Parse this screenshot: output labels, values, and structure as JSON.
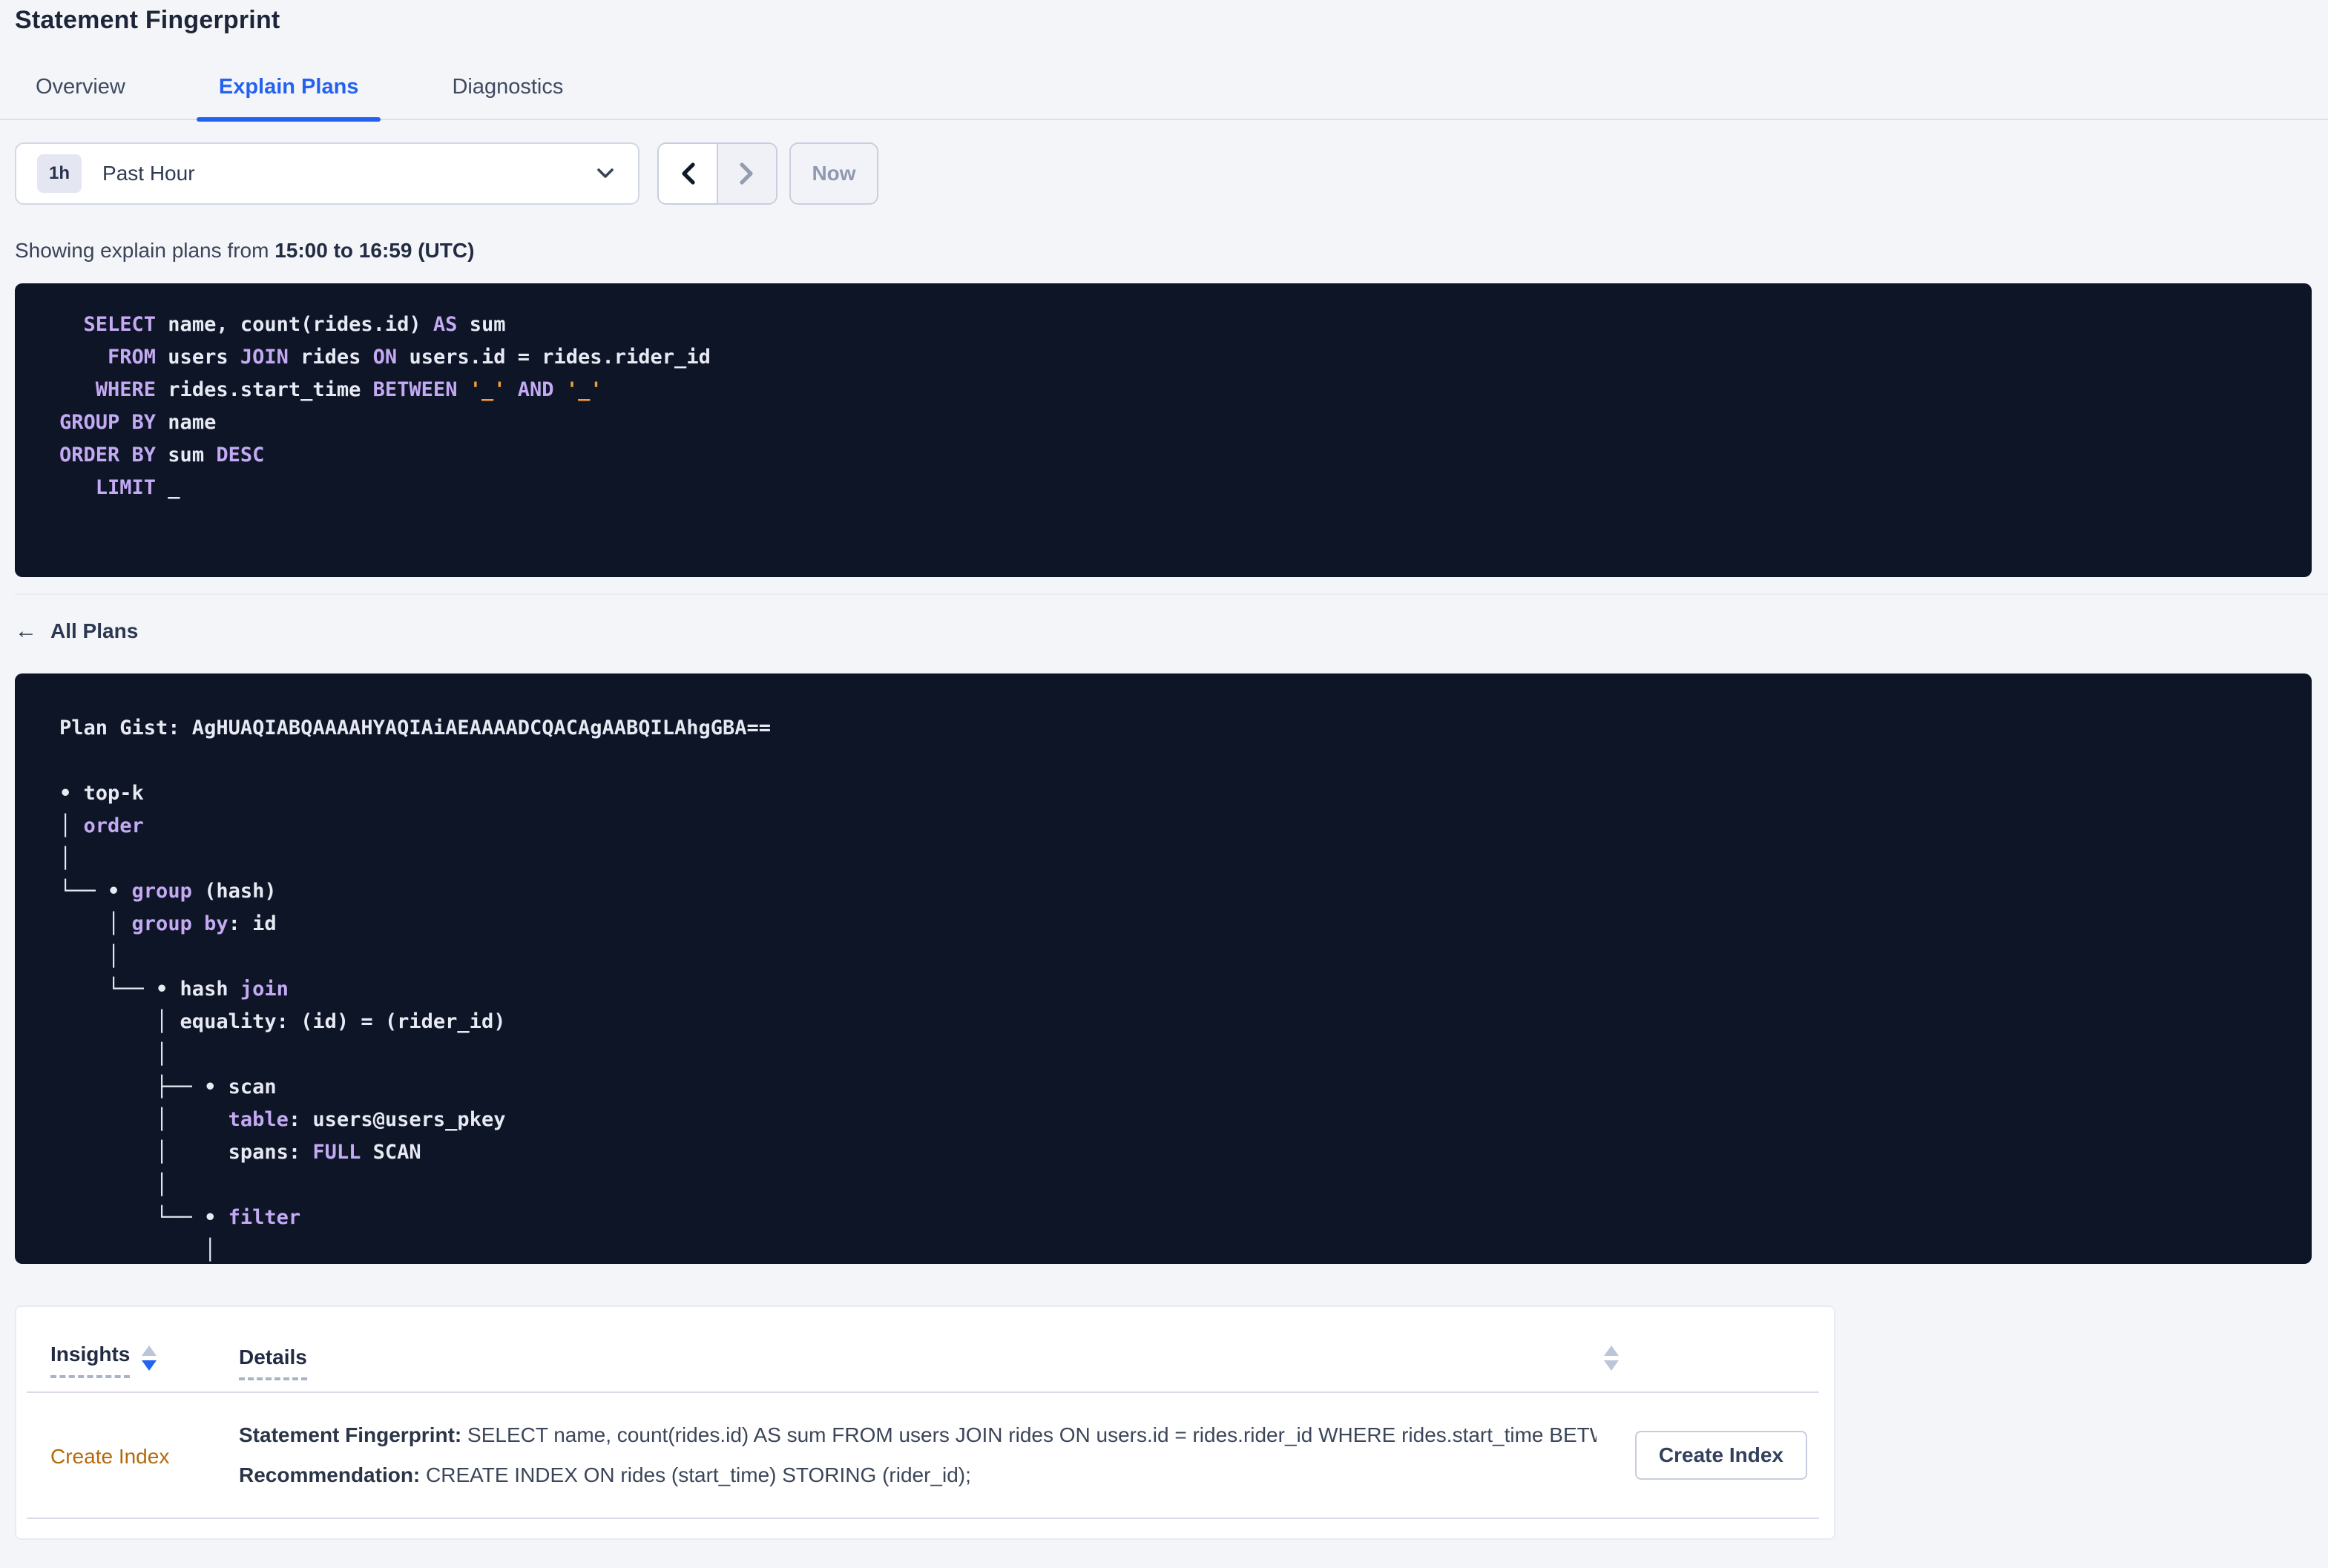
{
  "header": {
    "title": "Statement Fingerprint"
  },
  "tabs": {
    "items": [
      {
        "label": "Overview",
        "active": false
      },
      {
        "label": "Explain Plans",
        "active": true
      },
      {
        "label": "Diagnostics",
        "active": false
      }
    ]
  },
  "toolbar": {
    "time_window_badge": "1h",
    "time_window_label": "Past Hour",
    "caret_icon": "chevron-down-icon",
    "prev_icon": "chevron-left-icon",
    "next_icon": "chevron-right-icon",
    "now_label": "Now"
  },
  "showing": {
    "prefix": "Showing explain plans from ",
    "bold_range": "15:00 to 16:59 (UTC)"
  },
  "colors": {
    "page_background": "#f4f5f9",
    "accent_blue": "#2362f1",
    "code_background": "#0d1527",
    "code_plain": "#e7eaf3",
    "code_keyword": "#c4a9f3",
    "code_string": "#f59d3c",
    "insight_link_orange": "#b5690b",
    "sort_active_blue": "#2264f0"
  },
  "sql_block": {
    "lines": [
      [
        [
          "k",
          "  SELECT"
        ],
        [
          "p",
          " name, count(rides.id) "
        ],
        [
          "k",
          "AS"
        ],
        [
          "p",
          " sum"
        ]
      ],
      [
        [
          "k",
          "    FROM"
        ],
        [
          "p",
          " users "
        ],
        [
          "k",
          "JOIN"
        ],
        [
          "p",
          " rides "
        ],
        [
          "k",
          "ON"
        ],
        [
          "p",
          " users.id = rides.rider_id"
        ]
      ],
      [
        [
          "k",
          "   WHERE"
        ],
        [
          "p",
          " rides.start_time "
        ],
        [
          "k",
          "BETWEEN"
        ],
        [
          "p",
          " "
        ],
        [
          "s",
          "'_'"
        ],
        [
          "p",
          " "
        ],
        [
          "k",
          "AND"
        ],
        [
          "p",
          " "
        ],
        [
          "s",
          "'_'"
        ]
      ],
      [
        [
          "k",
          "GROUP BY"
        ],
        [
          "p",
          " name"
        ]
      ],
      [
        [
          "k",
          "ORDER BY"
        ],
        [
          "p",
          " sum "
        ],
        [
          "k",
          "DESC"
        ]
      ],
      [
        [
          "k",
          "   LIMIT"
        ],
        [
          "p",
          " _"
        ]
      ]
    ]
  },
  "plans_nav": {
    "back_label": "All Plans",
    "back_icon": "arrow-left-icon",
    "back_arrow_glyph": "←"
  },
  "plan_gist_block": {
    "gist_label": "Plan Gist:",
    "gist_value": "AgHUAQIABQAAAAHYAQIAiAEAAAADCQACAgAABQILAhgGBA==",
    "lines": [
      [
        [
          "p",
          "Plan Gist: AgHUAQIABQAAAAHYAQIAiAEAAAADCQACAgAABQILAhgGBA=="
        ]
      ],
      [],
      [
        [
          "p",
          "• top-k"
        ]
      ],
      [
        [
          "p",
          "│ "
        ],
        [
          "k",
          "order"
        ]
      ],
      [
        [
          "p",
          "│"
        ]
      ],
      [
        [
          "p",
          "└── • "
        ],
        [
          "k",
          "group"
        ],
        [
          "p",
          " (hash)"
        ]
      ],
      [
        [
          "p",
          "    │ "
        ],
        [
          "k",
          "group by"
        ],
        [
          "p",
          ": id"
        ]
      ],
      [
        [
          "p",
          "    │"
        ]
      ],
      [
        [
          "p",
          "    └── • hash "
        ],
        [
          "k",
          "join"
        ]
      ],
      [
        [
          "p",
          "        │ equality: (id) = (rider_id)"
        ]
      ],
      [
        [
          "p",
          "        │"
        ]
      ],
      [
        [
          "p",
          "        ├── • scan"
        ]
      ],
      [
        [
          "p",
          "        │     "
        ],
        [
          "k",
          "table"
        ],
        [
          "p",
          ": users@users_pkey"
        ]
      ],
      [
        [
          "p",
          "        │     spans: "
        ],
        [
          "k",
          "FULL"
        ],
        [
          "p",
          " SCAN"
        ]
      ],
      [
        [
          "p",
          "        │"
        ]
      ],
      [
        [
          "p",
          "        └── • "
        ],
        [
          "k",
          "filter"
        ]
      ],
      [
        [
          "p",
          "            │"
        ]
      ],
      [
        [
          "p",
          "            │"
        ]
      ]
    ]
  },
  "insights_table": {
    "columns": [
      {
        "label": "Insights",
        "sort": "desc"
      },
      {
        "label": "Details",
        "sort": "none"
      }
    ],
    "rows": [
      {
        "insight": "Create Index",
        "detail_line1_label": "Statement Fingerprint:",
        "detail_line1_text": " SELECT name, count(rides.id) AS sum FROM users JOIN rides ON users.id = rides.rider_id WHERE rides.start_time BETWEEN '_…",
        "detail_line2_label": "Recommendation:",
        "detail_line2_text": " CREATE INDEX ON rides (start_time) STORING (rider_id);",
        "action_label": "Create Index"
      }
    ]
  }
}
